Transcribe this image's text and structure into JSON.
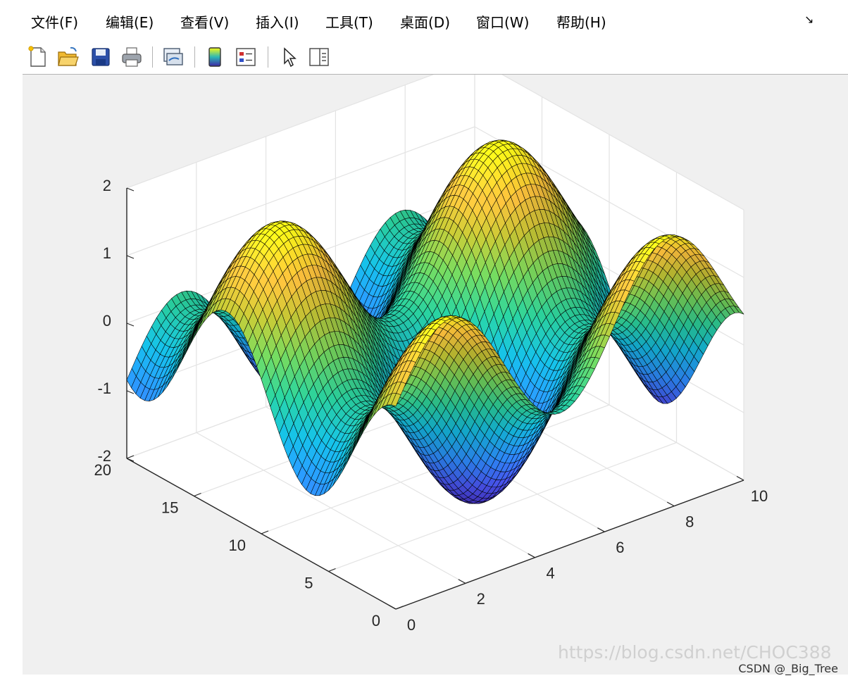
{
  "menu": [
    {
      "label": "文件(F)"
    },
    {
      "label": "编辑(E)"
    },
    {
      "label": "查看(V)"
    },
    {
      "label": "插入(I)"
    },
    {
      "label": "工具(T)"
    },
    {
      "label": "桌面(D)"
    },
    {
      "label": "窗口(W)"
    },
    {
      "label": "帮助(H)"
    }
  ],
  "menu_dock_icon": "dock-arrow-icon",
  "toolbar": [
    {
      "name": "new-figure-icon"
    },
    {
      "name": "open-file-icon"
    },
    {
      "name": "save-icon"
    },
    {
      "name": "print-icon"
    },
    {
      "name": "link-plot-icon"
    },
    {
      "name": "insert-colorbar-icon"
    },
    {
      "name": "insert-legend-icon"
    },
    {
      "name": "edit-plot-pointer-icon"
    },
    {
      "name": "property-inspector-icon"
    }
  ],
  "chart_data": {
    "type": "surface",
    "description_function": "z = sin(x) + cos(y/2)",
    "x": {
      "range": [
        0,
        10
      ],
      "ticks": [
        0,
        2,
        4,
        6,
        8,
        10
      ]
    },
    "y": {
      "range": [
        0,
        20
      ],
      "ticks": [
        0,
        5,
        10,
        15,
        20
      ]
    },
    "z": {
      "range": [
        -2,
        2
      ],
      "ticks": [
        -2,
        -1,
        0,
        1,
        2
      ]
    },
    "z_min": -2,
    "z_max": 2,
    "colormap": "parula",
    "edgecolor": "#000000",
    "grid": true,
    "view": "default 3-D (az -37.5, el 30)"
  },
  "colors": {
    "canvas_bg": "#f0f0f0",
    "axes_face": "#ffffff",
    "grid": "#e3e3e3"
  },
  "watermark": "https://blog.csdn.net/CHOC388",
  "credit": "CSDN @_Big_Tree"
}
